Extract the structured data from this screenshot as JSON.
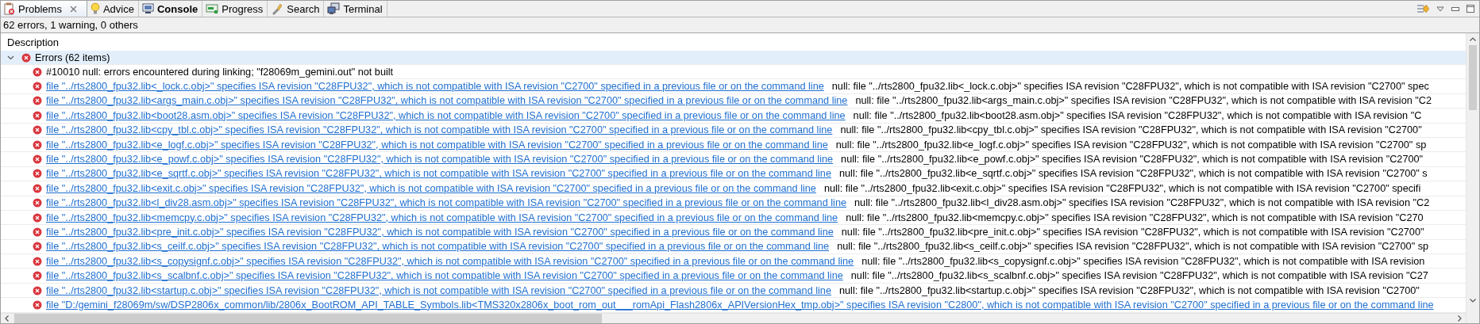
{
  "tabs": [
    {
      "label": "Problems",
      "selected": true,
      "emphasized": false,
      "closable": true
    },
    {
      "label": "Advice",
      "selected": false,
      "emphasized": false,
      "closable": false
    },
    {
      "label": "Console",
      "selected": false,
      "emphasized": true,
      "closable": false
    },
    {
      "label": "Progress",
      "selected": false,
      "emphasized": false,
      "closable": false
    },
    {
      "label": "Search",
      "selected": false,
      "emphasized": false,
      "closable": false
    },
    {
      "label": "Terminal",
      "selected": false,
      "emphasized": false,
      "closable": false
    }
  ],
  "summary": "62 errors, 1 warning, 0 others",
  "table": {
    "columns": [
      "Description"
    ],
    "group": {
      "label": "Errors (62 items)",
      "expanded": true,
      "selected": true,
      "items": [
        {
          "kind": "plain",
          "message": "#10010 null: errors encountered during linking; \"f28069m_gemini.out\" not built"
        },
        {
          "kind": "link",
          "message": "file \"../rts2800_fpu32.lib<_lock.c.obj>\" specifies ISA revision \"C28FPU32\", which is not compatible with ISA revision \"C2700\" specified in a previous file or on the command line",
          "detail": "null: file \"../rts2800_fpu32.lib<_lock.c.obj>\" specifies ISA revision \"C28FPU32\", which is not compatible with ISA revision \"C2700\" spec"
        },
        {
          "kind": "link",
          "message": "file \"../rts2800_fpu32.lib<args_main.c.obj>\" specifies ISA revision \"C28FPU32\", which is not compatible with ISA revision \"C2700\" specified in a previous file or on the command line",
          "detail": "null: file \"../rts2800_fpu32.lib<args_main.c.obj>\" specifies ISA revision \"C28FPU32\", which is not compatible with ISA revision \"C2"
        },
        {
          "kind": "link",
          "message": "file \"../rts2800_fpu32.lib<boot28.asm.obj>\" specifies ISA revision \"C28FPU32\", which is not compatible with ISA revision \"C2700\" specified in a previous file or on the command line",
          "detail": "null: file \"../rts2800_fpu32.lib<boot28.asm.obj>\" specifies ISA revision \"C28FPU32\", which is not compatible with ISA revision \"C"
        },
        {
          "kind": "link",
          "message": "file \"../rts2800_fpu32.lib<cpy_tbl.c.obj>\" specifies ISA revision \"C28FPU32\", which is not compatible with ISA revision \"C2700\" specified in a previous file or on the command line",
          "detail": "null: file \"../rts2800_fpu32.lib<cpy_tbl.c.obj>\" specifies ISA revision \"C28FPU32\", which is not compatible with ISA revision \"C2700\""
        },
        {
          "kind": "link",
          "message": "file \"../rts2800_fpu32.lib<e_logf.c.obj>\" specifies ISA revision \"C28FPU32\", which is not compatible with ISA revision \"C2700\" specified in a previous file or on the command line",
          "detail": "null: file \"../rts2800_fpu32.lib<e_logf.c.obj>\" specifies ISA revision \"C28FPU32\", which is not compatible with ISA revision \"C2700\" sp"
        },
        {
          "kind": "link",
          "message": "file \"../rts2800_fpu32.lib<e_powf.c.obj>\" specifies ISA revision \"C28FPU32\", which is not compatible with ISA revision \"C2700\" specified in a previous file or on the command line",
          "detail": "null: file \"../rts2800_fpu32.lib<e_powf.c.obj>\" specifies ISA revision \"C28FPU32\", which is not compatible with ISA revision \"C2700\""
        },
        {
          "kind": "link",
          "message": "file \"../rts2800_fpu32.lib<e_sqrtf.c.obj>\" specifies ISA revision \"C28FPU32\", which is not compatible with ISA revision \"C2700\" specified in a previous file or on the command line",
          "detail": "null: file \"../rts2800_fpu32.lib<e_sqrtf.c.obj>\" specifies ISA revision \"C28FPU32\", which is not compatible with ISA revision \"C2700\" s"
        },
        {
          "kind": "link",
          "message": "file \"../rts2800_fpu32.lib<exit.c.obj>\" specifies ISA revision \"C28FPU32\", which is not compatible with ISA revision \"C2700\" specified in a previous file or on the command line",
          "detail": "null: file \"../rts2800_fpu32.lib<exit.c.obj>\" specifies ISA revision \"C28FPU32\", which is not compatible with ISA revision \"C2700\" specifi"
        },
        {
          "kind": "link",
          "message": "file \"../rts2800_fpu32.lib<l_div28.asm.obj>\" specifies ISA revision \"C28FPU32\", which is not compatible with ISA revision \"C2700\" specified in a previous file or on the command line",
          "detail": "null: file \"../rts2800_fpu32.lib<l_div28.asm.obj>\" specifies ISA revision \"C28FPU32\", which is not compatible with ISA revision \"C2"
        },
        {
          "kind": "link",
          "message": "file \"../rts2800_fpu32.lib<memcpy.c.obj>\" specifies ISA revision \"C28FPU32\", which is not compatible with ISA revision \"C2700\" specified in a previous file or on the command line",
          "detail": "null: file \"../rts2800_fpu32.lib<memcpy.c.obj>\" specifies ISA revision \"C28FPU32\", which is not compatible with ISA revision \"C270"
        },
        {
          "kind": "link",
          "message": "file \"../rts2800_fpu32.lib<pre_init.c.obj>\" specifies ISA revision \"C28FPU32\", which is not compatible with ISA revision \"C2700\" specified in a previous file or on the command line",
          "detail": "null: file \"../rts2800_fpu32.lib<pre_init.c.obj>\" specifies ISA revision \"C28FPU32\", which is not compatible with ISA revision \"C2700\""
        },
        {
          "kind": "link",
          "message": "file \"../rts2800_fpu32.lib<s_ceilf.c.obj>\" specifies ISA revision \"C28FPU32\", which is not compatible with ISA revision \"C2700\" specified in a previous file or on the command line",
          "detail": "null: file \"../rts2800_fpu32.lib<s_ceilf.c.obj>\" specifies ISA revision \"C28FPU32\", which is not compatible with ISA revision \"C2700\" sp"
        },
        {
          "kind": "link",
          "message": "file \"../rts2800_fpu32.lib<s_copysignf.c.obj>\" specifies ISA revision \"C28FPU32\", which is not compatible with ISA revision \"C2700\" specified in a previous file or on the command line",
          "detail": "null: file \"../rts2800_fpu32.lib<s_copysignf.c.obj>\" specifies ISA revision \"C28FPU32\", which is not compatible with ISA revision"
        },
        {
          "kind": "link",
          "message": "file \"../rts2800_fpu32.lib<s_scalbnf.c.obj>\" specifies ISA revision \"C28FPU32\", which is not compatible with ISA revision \"C2700\" specified in a previous file or on the command line",
          "detail": "null: file \"../rts2800_fpu32.lib<s_scalbnf.c.obj>\" specifies ISA revision \"C28FPU32\", which is not compatible with ISA revision \"C27"
        },
        {
          "kind": "link",
          "message": "file \"../rts2800_fpu32.lib<startup.c.obj>\" specifies ISA revision \"C28FPU32\", which is not compatible with ISA revision \"C2700\" specified in a previous file or on the command line",
          "detail": "null: file \"../rts2800_fpu32.lib<startup.c.obj>\" specifies ISA revision \"C28FPU32\", which is not compatible with ISA revision \"C2700\""
        },
        {
          "kind": "link",
          "message": "file \"D:/gemini_f28069m/sw/DSP2806x_common/lib/2806x_BootROM_API_TABLE_Symbols.lib<TMS320x2806x_boot_rom_out___romApi_Flash2806x_APIVersionHex_tmp.obj>\" specifies ISA revision \"C2800\", which is not compatible with ISA revision \"C2700\" specified in a previous file or on the command line"
        }
      ]
    }
  }
}
